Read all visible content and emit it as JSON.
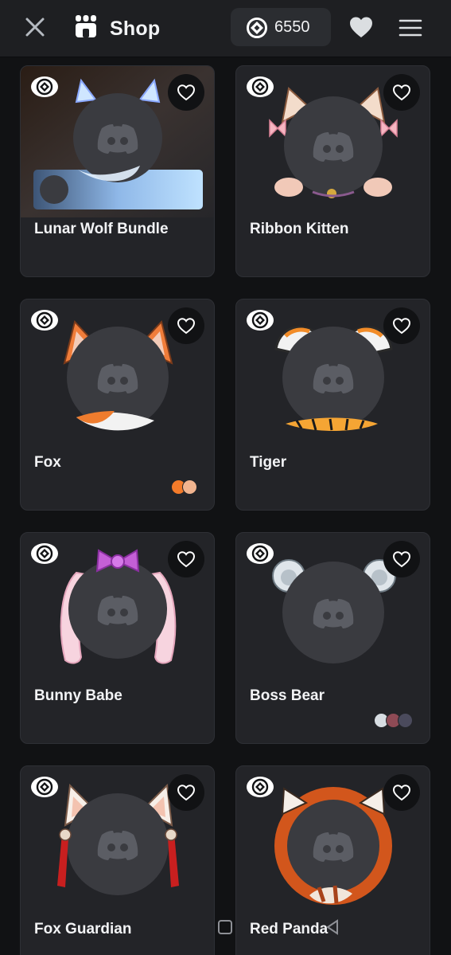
{
  "header": {
    "title": "Shop",
    "orb_balance": "6550",
    "icons": [
      "close-icon",
      "shop-icon",
      "orb-icon",
      "heart-icon",
      "hamburger-menu-icon"
    ]
  },
  "colors": {
    "background": "#111214",
    "topbar": "#1e1f22",
    "card": "#232428",
    "avatar_placeholder": "#3a3b40",
    "discord_logo": "#5b5d64"
  },
  "products": [
    {
      "name": "Lunar Wolf Bundle",
      "bundle": true,
      "swatches": []
    },
    {
      "name": "Ribbon Kitten",
      "swatches": []
    },
    {
      "name": "Fox",
      "swatches": [
        "#f47b2a",
        "#f1b48f"
      ]
    },
    {
      "name": "Tiger",
      "swatches": []
    },
    {
      "name": "Bunny Babe",
      "swatches": []
    },
    {
      "name": "Boss Bear",
      "swatches": [
        "#d7dde2",
        "#8e4a55",
        "#4a4a5c"
      ]
    },
    {
      "name": "Fox Guardian",
      "swatches": []
    },
    {
      "name": "Red Panda",
      "swatches": []
    }
  ]
}
